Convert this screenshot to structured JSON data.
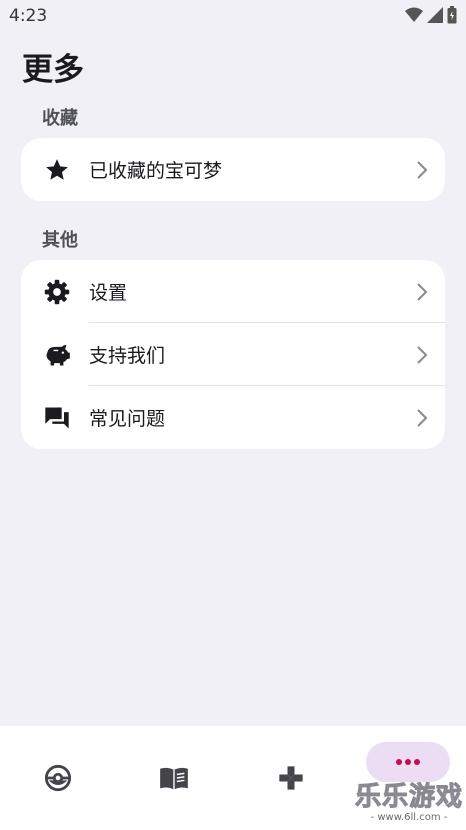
{
  "status": {
    "time": "4:23"
  },
  "page": {
    "title": "更多"
  },
  "sections": {
    "favorites": {
      "label": "收藏",
      "items": [
        {
          "label": "已收藏的宝可梦",
          "icon": "star-icon"
        }
      ]
    },
    "other": {
      "label": "其他",
      "items": [
        {
          "label": "设置",
          "icon": "gear-icon"
        },
        {
          "label": "支持我们",
          "icon": "piggy-bank-icon"
        },
        {
          "label": "常见问题",
          "icon": "forum-icon"
        }
      ]
    }
  },
  "nav": {
    "items": [
      {
        "icon": "pokeball-icon"
      },
      {
        "icon": "book-icon"
      },
      {
        "icon": "gamepad-icon"
      },
      {
        "icon": "more-dots-icon",
        "selected": true
      }
    ],
    "accent": "#c0114a",
    "selected_pill": "#ecdcf4"
  },
  "watermark": {
    "main": "乐乐游戏",
    "sub": "- www.6ll.com -"
  }
}
